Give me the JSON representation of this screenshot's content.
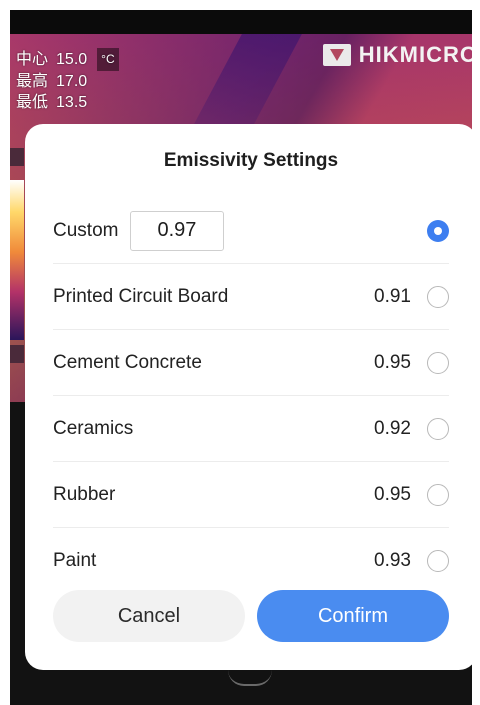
{
  "overlay": {
    "readings": [
      {
        "label": "中心",
        "value": "15.0",
        "unit": "°C"
      },
      {
        "label": "最高",
        "value": "17.0"
      },
      {
        "label": "最低",
        "value": "13.5"
      }
    ],
    "brand": "HIKMICRO"
  },
  "dialog": {
    "title": "Emissivity Settings",
    "custom": {
      "label": "Custom",
      "value": "0.97",
      "selected": true
    },
    "options": [
      {
        "label": "Printed Circuit Board",
        "value": "0.91",
        "selected": false
      },
      {
        "label": "Cement Concrete",
        "value": "0.95",
        "selected": false
      },
      {
        "label": "Ceramics",
        "value": "0.92",
        "selected": false
      },
      {
        "label": "Rubber",
        "value": "0.95",
        "selected": false
      },
      {
        "label": "Paint",
        "value": "0.93",
        "selected": false
      }
    ],
    "cancel_label": "Cancel",
    "confirm_label": "Confirm"
  },
  "colors": {
    "accent": "#3d7ef0",
    "confirm": "#4a8cf0",
    "cancel_bg": "#f2f2f2"
  },
  "icons": {
    "radio_selected": "radio-checked-icon",
    "radio_unselected": "radio-unchecked-icon",
    "brand": "hikmicro-logo-icon"
  }
}
